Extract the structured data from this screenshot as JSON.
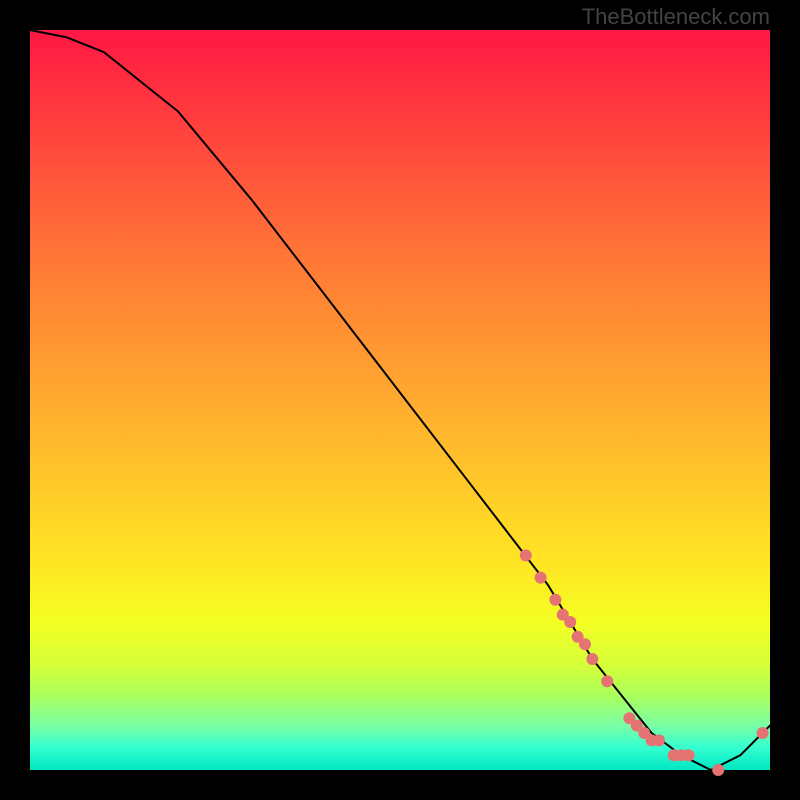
{
  "watermark": "TheBottleneck.com",
  "chart_data": {
    "type": "line",
    "title": "",
    "xlabel": "",
    "ylabel": "",
    "xlim": [
      0,
      100
    ],
    "ylim": [
      0,
      100
    ],
    "series": [
      {
        "name": "curve",
        "x": [
          0,
          5,
          10,
          20,
          30,
          40,
          50,
          60,
          70,
          76,
          80,
          84,
          88,
          92,
          96,
          100
        ],
        "y": [
          100,
          99,
          97,
          89,
          77,
          64,
          51,
          38,
          25,
          15,
          10,
          5,
          2,
          0,
          2,
          6
        ]
      }
    ],
    "markers": {
      "name": "points",
      "x": [
        67,
        69,
        71,
        72,
        73,
        74,
        75,
        76,
        78,
        81,
        82,
        83,
        84,
        85,
        87,
        88,
        89,
        93,
        99
      ],
      "y": [
        29,
        26,
        23,
        21,
        20,
        18,
        17,
        15,
        12,
        7,
        6,
        5,
        4,
        4,
        2,
        2,
        2,
        0,
        5
      ]
    }
  }
}
